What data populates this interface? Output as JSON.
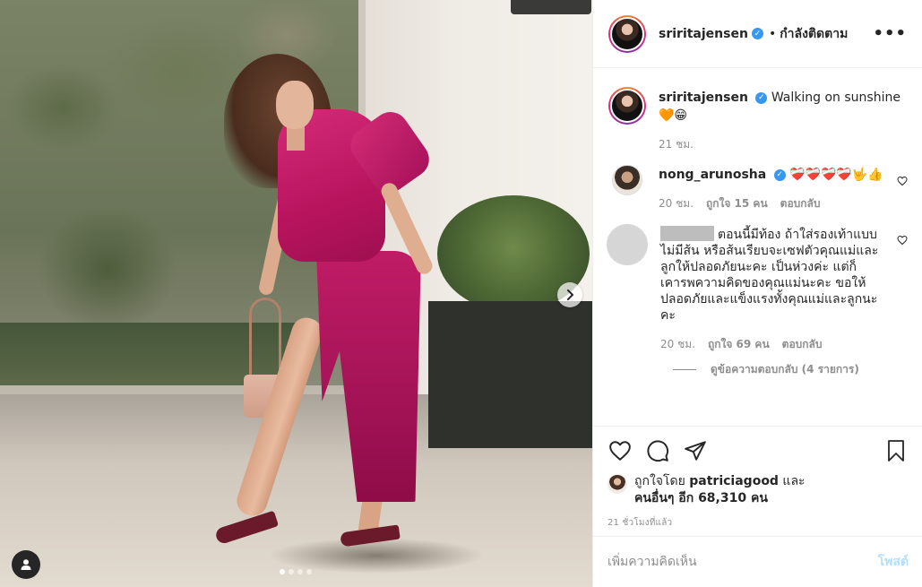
{
  "post": {
    "username": "sriritajensen",
    "follow_status": "กำลังติดตาม",
    "more_icon": "more-options-icon",
    "caption": {
      "username": "sriritajensen",
      "text": "Walking on sunshine",
      "emoji": "🧡😁",
      "time": "21 ชม."
    }
  },
  "comments": [
    {
      "username": "nong_arunosha",
      "text": "❤️‍🩹❤️‍🩹❤️‍🩹❤️‍🩹🤟👍",
      "time": "20 ชม.",
      "likes": "ถูกใจ 15 คน",
      "reply": "ตอบกลับ"
    },
    {
      "username": "",
      "text": "ตอนนี้มีท้อง ถ้าใส่รองเท้าแบบไม่มีส้น หรือส้นเรียบจะเซฟตัวคุณแม่และลูกให้ปลอดภัยนะคะ เป็นห่วงค่ะ แต่ก็เคารพความคิดของคุณแม่นะคะ ขอให้ปลอดภัยและแข็งแรงทั้งคุณแม่และลูกนะคะ",
      "time": "20 ชม.",
      "likes": "ถูกใจ 69 คน",
      "reply": "ตอบกลับ",
      "view_replies": "ดูข้อความตอบกลับ (4 รายการ)"
    }
  ],
  "likes_summary": {
    "prefix": "ถูกใจโดย",
    "user": "patriciagood",
    "and": "และ",
    "others": "คนอื่นๆ อีก 68,310 คน"
  },
  "posted_ago": "21 ชั่วโมงที่แล้ว",
  "add_comment": {
    "placeholder": "เพิ่มความคิดเห็น",
    "post_label": "โพสต์"
  },
  "carousel": {
    "total": 4,
    "current": 1
  },
  "colors": {
    "accent": "#3897f0",
    "post_disabled": "#b2dffc",
    "dress": "#c01c66"
  }
}
